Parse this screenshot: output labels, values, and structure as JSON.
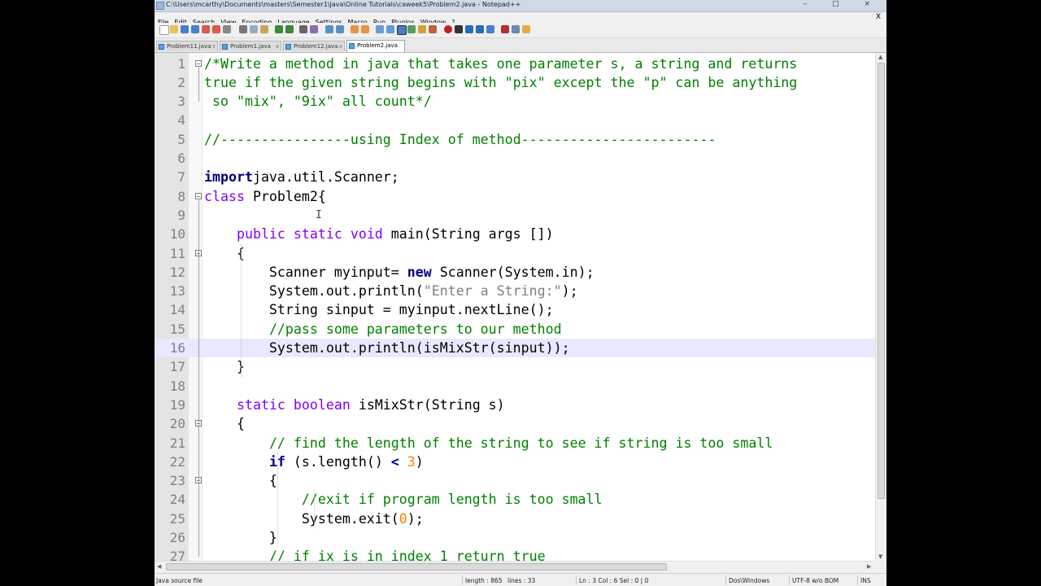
{
  "window": {
    "title": "C:\\Users\\mcarthy\\Documents\\masters\\Semester1\\Java\\Online Tutorials\\caweek5\\Problem2.java - Notepad++",
    "controls": "– □ ×"
  },
  "menu": [
    "File",
    "Edit",
    "Search",
    "View",
    "Encoding",
    "Language",
    "Settings",
    "Macro",
    "Run",
    "Plugins",
    "Window",
    "?"
  ],
  "menu_close": "X",
  "tabs": [
    {
      "label": "Problem11.java"
    },
    {
      "label": "Problem1.java"
    },
    {
      "label": "Problem12.java"
    },
    {
      "label": "Problem2.java",
      "active": true
    }
  ],
  "tab_close": "x",
  "code_lines": [
    {
      "n": "1",
      "tokens": [
        [
          "cm",
          "/*Write a method in java that takes one parameter s, a string and returns"
        ]
      ]
    },
    {
      "n": "2",
      "tokens": [
        [
          "cm",
          "true if the given string begins with \"pix\" except the \"p\" can be anything"
        ]
      ]
    },
    {
      "n": "3",
      "tokens": [
        [
          "cm",
          " so \"mix\", \"9ix\" all count*/"
        ]
      ]
    },
    {
      "n": "4",
      "tokens": []
    },
    {
      "n": "5",
      "tokens": [
        [
          "cm",
          "//----------------using Index of method------------------------"
        ]
      ]
    },
    {
      "n": "6",
      "tokens": []
    },
    {
      "n": "7",
      "tokens": [
        [
          "kw",
          "import"
        ],
        [
          "",
          "java.util.Scanner;"
        ]
      ]
    },
    {
      "n": "8",
      "tokens": [
        [
          "kw2",
          "class"
        ],
        [
          "",
          " Problem2{"
        ]
      ]
    },
    {
      "n": "9",
      "tokens": []
    },
    {
      "n": "10",
      "tokens": [
        [
          "",
          "    "
        ],
        [
          "kw2",
          "public static void"
        ],
        [
          "",
          " main(String args [])"
        ]
      ]
    },
    {
      "n": "11",
      "tokens": [
        [
          "",
          "    {"
        ]
      ]
    },
    {
      "n": "12",
      "tokens": [
        [
          "",
          "        Scanner myinput= "
        ],
        [
          "kw",
          "new"
        ],
        [
          "",
          " Scanner(System.in);"
        ]
      ]
    },
    {
      "n": "13",
      "tokens": [
        [
          "",
          "        System.out.println("
        ],
        [
          "st",
          "\"Enter a String:\""
        ],
        [
          "",
          ");"
        ]
      ]
    },
    {
      "n": "14",
      "tokens": [
        [
          "",
          "        String sinput = myinput.nextLine();"
        ]
      ]
    },
    {
      "n": "15",
      "tokens": [
        [
          "",
          "        "
        ],
        [
          "cm",
          "//pass some parameters to our method"
        ]
      ]
    },
    {
      "n": "16",
      "tokens": [
        [
          "",
          "        System.out.println(isMixStr(sinput));"
        ]
      ]
    },
    {
      "n": "17",
      "tokens": [
        [
          "",
          "    }"
        ]
      ]
    },
    {
      "n": "18",
      "tokens": []
    },
    {
      "n": "19",
      "tokens": [
        [
          "",
          "    "
        ],
        [
          "kw2",
          "static boolean"
        ],
        [
          "",
          " isMixStr(String s)"
        ]
      ]
    },
    {
      "n": "20",
      "tokens": [
        [
          "",
          "    {"
        ]
      ]
    },
    {
      "n": "21",
      "tokens": [
        [
          "",
          "        "
        ],
        [
          "cm",
          "// find the length of the string to see if string is too small"
        ]
      ]
    },
    {
      "n": "22",
      "tokens": [
        [
          "",
          "        "
        ],
        [
          "kw",
          "if"
        ],
        [
          "",
          " (s.length() "
        ],
        [
          "op",
          "<"
        ],
        [
          "",
          " "
        ],
        [
          "nm",
          "3"
        ],
        [
          "",
          ")"
        ]
      ]
    },
    {
      "n": "23",
      "tokens": [
        [
          "",
          "        {"
        ]
      ]
    },
    {
      "n": "24",
      "tokens": [
        [
          "",
          "            "
        ],
        [
          "cm",
          "//exit if program length is too small"
        ]
      ]
    },
    {
      "n": "25",
      "tokens": [
        [
          "",
          "            System.exit("
        ],
        [
          "nm",
          "0"
        ],
        [
          "",
          ");"
        ]
      ]
    },
    {
      "n": "26",
      "tokens": [
        [
          "",
          "        }"
        ]
      ]
    },
    {
      "n": "27",
      "tokens": [
        [
          "",
          "        "
        ],
        [
          "cm",
          "// if ix is in index 1 return true"
        ]
      ]
    }
  ],
  "status": {
    "file_type": "Java source file",
    "length": "length : 865",
    "lines": "lines : 33",
    "position": "Ln : 3   Col : 6   Sel : 0 | 0",
    "eol": "Dos\\Windows",
    "encoding": "UTF-8 w/o BOM",
    "mode": "INS"
  },
  "icons": [
    "app-icon",
    "new-file-icon",
    "open-file-icon",
    "save-icon",
    "save-all-icon",
    "close-icon",
    "close-all-icon",
    "print-icon",
    "cut-icon",
    "copy-icon",
    "paste-icon",
    "undo-icon",
    "redo-icon",
    "find-icon",
    "replace-icon",
    "zoom-in-icon",
    "zoom-out-icon",
    "sync-v-icon",
    "sync-h-icon",
    "wrap-icon",
    "show-all-icon",
    "indent-guide-icon",
    "lang-icon",
    "doc-map-icon",
    "func-list-icon",
    "record-macro-icon",
    "stop-macro-icon",
    "play-macro-icon",
    "play-multi-icon",
    "save-macro-icon",
    "spell-icon",
    "monitor-icon",
    "folder-icon"
  ],
  "colors": {
    "comment": "#008000",
    "keyword": "#000080",
    "type": "#8000ff",
    "string": "#808080",
    "number": "#ff8000",
    "gutter": "#e4e4e4",
    "current_line": "#e8e8ff"
  }
}
